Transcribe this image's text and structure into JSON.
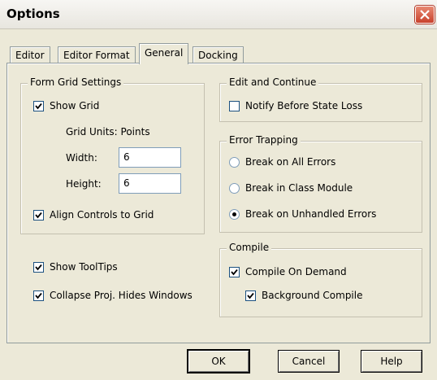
{
  "window": {
    "title": "Options"
  },
  "tabs": [
    "Editor",
    "Editor Format",
    "General",
    "Docking"
  ],
  "active_tab": "General",
  "form_grid": {
    "title": "Form Grid Settings",
    "show_grid": "Show Grid",
    "grid_units": "Grid Units:  Points",
    "width_label": "Width:",
    "width_value": "6",
    "height_label": "Height:",
    "height_value": "6",
    "align_controls": "Align Controls to Grid"
  },
  "show_tooltips": "Show ToolTips",
  "collapse_proj": "Collapse Proj. Hides Windows",
  "edit_continue": {
    "title": "Edit and Continue",
    "notify": "Notify Before State Loss"
  },
  "error_trapping": {
    "title": "Error Trapping",
    "options": [
      "Break on All Errors",
      "Break in Class Module",
      "Break on Unhandled Errors"
    ],
    "selected": "Break on Unhandled Errors"
  },
  "compile": {
    "title": "Compile",
    "on_demand": "Compile On Demand",
    "background": "Background Compile"
  },
  "buttons": {
    "ok": "OK",
    "cancel": "Cancel",
    "help": "Help"
  },
  "icons": {
    "close": "close-icon",
    "check": "checkmark-icon"
  }
}
